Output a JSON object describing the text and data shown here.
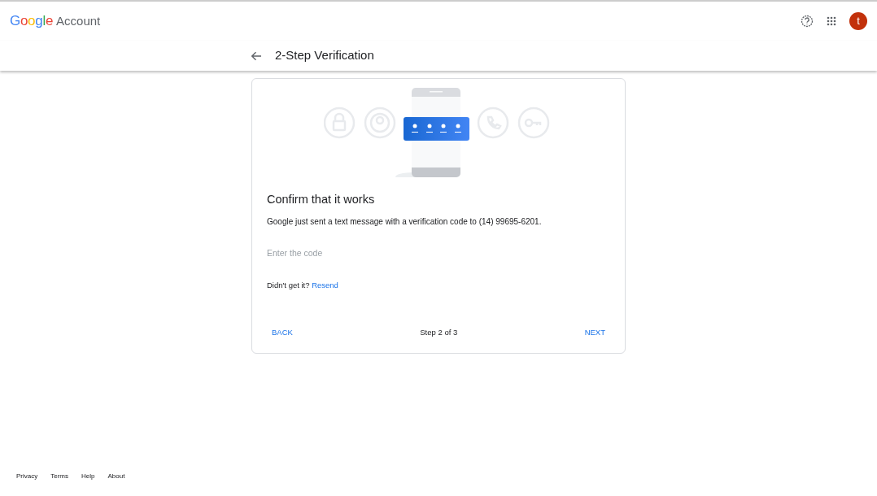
{
  "header": {
    "logo_brand": "Google",
    "logo_product": "Account",
    "avatar_letter": "t"
  },
  "page_title": "2-Step Verification",
  "card": {
    "heading": "Confirm that it works",
    "message": "Google just sent a text message with a verification code to (14) 99695-6201.",
    "code_field": {
      "placeholder": "Enter the code"
    },
    "resend_prompt": "Didn't get it?",
    "resend_link": "Resend",
    "back_button": "BACK",
    "step": "Step 2 of 3",
    "next_button": "NEXT"
  },
  "footer": [
    "Privacy",
    "Terms",
    "Help",
    "About"
  ]
}
